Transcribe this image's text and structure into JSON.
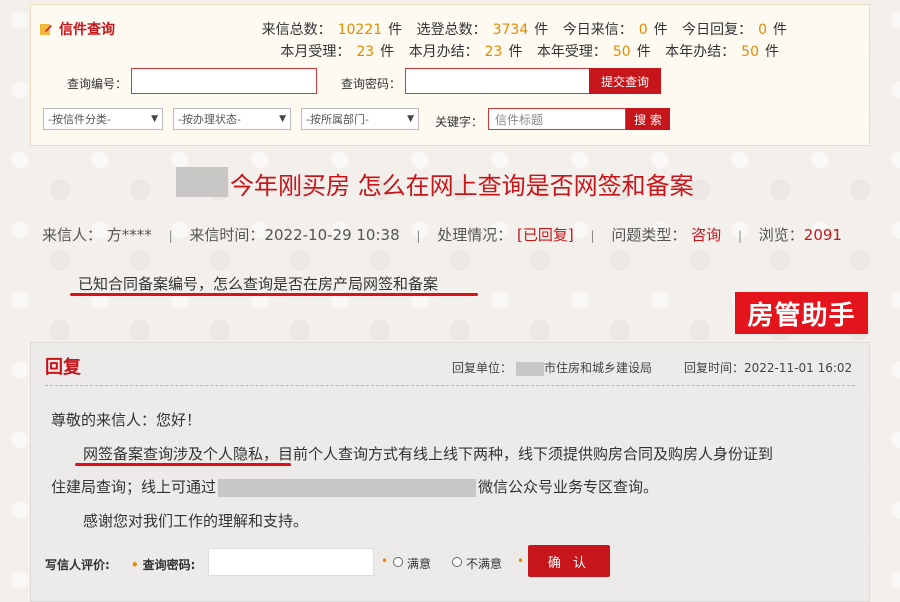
{
  "query_panel": {
    "title": "信件查询",
    "stats": {
      "total_letters_label": "来信总数：",
      "total_letters": "10221",
      "unit1": "件",
      "selected_label": "选登总数：",
      "selected": "3734",
      "unit2": "件",
      "today_in_label": "今日来信：",
      "today_in": "0",
      "unit3": "件",
      "today_reply_label": "今日回复：",
      "today_reply": "0",
      "unit4": "件",
      "month_accepted_label": "本月受理：",
      "month_accepted": "23",
      "unit5": "件",
      "month_done_label": "本月办结：",
      "month_done": "23",
      "unit6": "件",
      "year_accepted_label": "本年受理：",
      "year_accepted": "50",
      "unit7": "件",
      "year_done_label": "本年办结：",
      "year_done": "50",
      "unit8": "件"
    },
    "query_number_label": "查询编号：",
    "query_password_label": "查询密码：",
    "submit_query": "提交查询",
    "filter_category": "-按信件分类-",
    "filter_status": "-按办理状态-",
    "filter_dept": "-按所属部门-",
    "keyword_label": "关键字：",
    "keyword_placeholder": "信件标题",
    "search_button": "搜 索"
  },
  "article": {
    "title": "今年刚买房 怎么在网上查询是否网签和备案",
    "sender_label": "来信人：",
    "sender": "方****",
    "time_label": "来信时间：",
    "time": "2022-10-29 10:38",
    "status_label": "处理情况：",
    "status": "[已回复]",
    "type_label": "问题类型：",
    "type": "咨询",
    "views_label": "浏览：",
    "views": "2091",
    "question": "已知合同备案编号，怎么查询是否在房产局网签和备案"
  },
  "watermark": "房管助手",
  "reply": {
    "heading": "回复",
    "unit_label": "回复单位：",
    "unit": "市住房和城乡建设局",
    "time_label": "回复时间：",
    "time": "2022-11-01 16:02",
    "greeting": "尊敬的来信人：您好！",
    "p1": "网签备案查询涉及个人隐私，目前个人查询方式有线上线下两种，线下须提供购房合同及购房人身份证到",
    "p1b_start": "住建局查询；线上可通过",
    "p1b_end": "微信公众号业务专区查询。",
    "p2": "感谢您对我们工作的理解和支持。"
  },
  "evaluation": {
    "label": "写信人评价:",
    "password_label": "查询密码:",
    "satisfied": "满意",
    "unsatisfied": "不满意",
    "confirm": "确 认"
  }
}
